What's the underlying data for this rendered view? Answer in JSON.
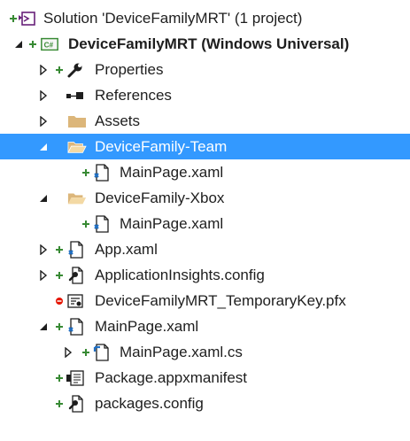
{
  "colors": {
    "selection": "#3399ff",
    "text": "#1e1e1e",
    "folder": "#dcb67a",
    "plus_badge": "#388a34",
    "error_badge": "#e51400",
    "file_blue": "#1f6fc4"
  },
  "tree": {
    "solution": {
      "label": "Solution 'DeviceFamilyMRT' (1 project)",
      "icon": "solution-icon"
    },
    "project": {
      "label": "DeviceFamilyMRT (Windows Universal)",
      "icon": "csharp-project-icon"
    },
    "properties": {
      "label": "Properties",
      "icon": "wrench-icon"
    },
    "references": {
      "label": "References",
      "icon": "references-icon"
    },
    "assets": {
      "label": "Assets",
      "icon": "folder-icon"
    },
    "team_folder": {
      "label": "DeviceFamily-Team",
      "icon": "open-folder-icon",
      "selected": true
    },
    "team_mainpage": {
      "label": "MainPage.xaml",
      "icon": "xaml-file-icon"
    },
    "xbox_folder": {
      "label": "DeviceFamily-Xbox",
      "icon": "open-folder-icon"
    },
    "xbox_mainpage": {
      "label": "MainPage.xaml",
      "icon": "xaml-file-icon"
    },
    "app_xaml": {
      "label": "App.xaml",
      "icon": "xaml-file-icon"
    },
    "appinsights": {
      "label": "ApplicationInsights.config",
      "icon": "config-file-icon"
    },
    "tempkey": {
      "label": "DeviceFamilyMRT_TemporaryKey.pfx",
      "icon": "certificate-icon"
    },
    "mainpage_xaml": {
      "label": "MainPage.xaml",
      "icon": "xaml-file-icon"
    },
    "mainpage_cs": {
      "label": "MainPage.xaml.cs",
      "icon": "csharp-file-icon"
    },
    "manifest": {
      "label": "Package.appxmanifest",
      "icon": "manifest-icon"
    },
    "packages_config": {
      "label": "packages.config",
      "icon": "config-file-icon"
    }
  }
}
